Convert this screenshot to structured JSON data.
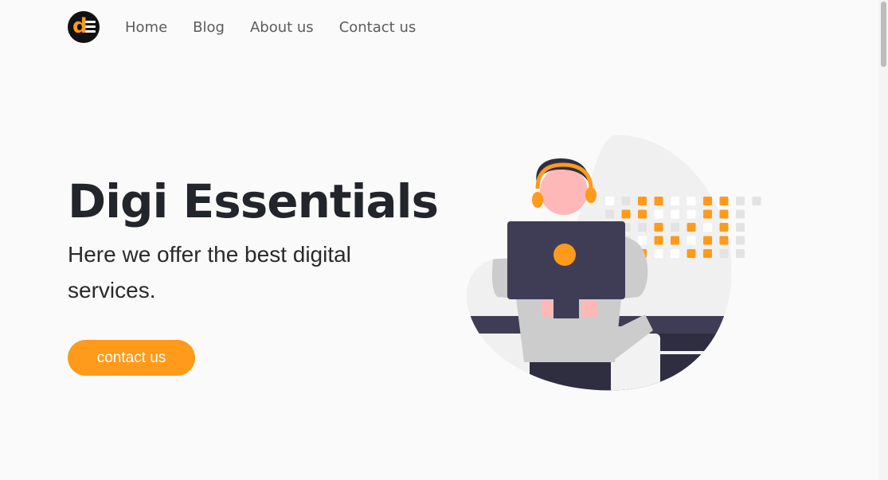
{
  "logo": {
    "letter": "d"
  },
  "nav": {
    "items": [
      {
        "label": "Home"
      },
      {
        "label": "Blog"
      },
      {
        "label": "About us"
      },
      {
        "label": "Contact us"
      }
    ]
  },
  "hero": {
    "title": "Digi Essentials",
    "subtitle": "Here we offer the best digital services.",
    "cta_label": "contact us"
  },
  "colors": {
    "accent": "#ff9a1a",
    "heading": "#22252b",
    "nav_text": "#5c5c5c",
    "background": "#fafafa",
    "dark_navy": "#3f3d56"
  },
  "illustration": {
    "icon": "person-at-computer-illustration"
  }
}
